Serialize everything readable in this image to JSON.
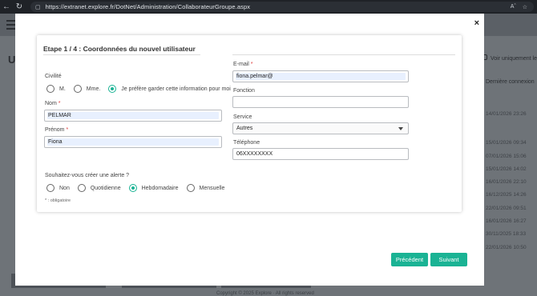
{
  "browser": {
    "url": "https://extranet.explore.fr/DotNet/Administration/CollaborateurGroupe.aspx",
    "reader_label": "Aˆ"
  },
  "background": {
    "title_fragment": "U",
    "right_checkbox_label": "Voir uniquement le",
    "column_header": "Dernière connexion",
    "dates": [
      "14/01/2026 23:26",
      "15/01/2026 09:34",
      "07/01/2026 15:06",
      "15/01/2026 14:02",
      "16/01/2026 22:10",
      "16/12/2025 14:26",
      "22/01/2026 09:51",
      "16/01/2026 16:27",
      "30/11/2025 18:33",
      "22/01/2026 10:50"
    ],
    "footer": "Copyright © 2025 Explore · All rights reserved"
  },
  "modal": {
    "close_glyph": "×",
    "step_title": "Etape 1 / 4 : Coordonnées du nouvel utilisateur",
    "civilite": {
      "label": "Civilité",
      "options": [
        "M.",
        "Mme.",
        "Je préfère garder cette information pour moi"
      ],
      "selected": 2
    },
    "nom": {
      "label": "Nom",
      "value": "PELMAR"
    },
    "prenom": {
      "label": "Prénom",
      "value": "Fiona"
    },
    "email": {
      "label": "E-mail",
      "value": "fiona.pelmar@"
    },
    "fonction": {
      "label": "Fonction",
      "value": ""
    },
    "service": {
      "label": "Service",
      "value": "Autres"
    },
    "telephone": {
      "label": "Téléphone",
      "value": "06XXXXXXXX"
    },
    "alerte": {
      "question": "Souhaitez-vous créer une alerte ?",
      "options": [
        "Non",
        "Quotidienne",
        "Hebdomadaire",
        "Mensuelle"
      ],
      "selected": 2
    },
    "required_marker": "*",
    "required_note": "* : obligatoire",
    "buttons": {
      "previous": "Précédent",
      "next": "Suivant"
    }
  },
  "colors": {
    "accent": "#1ab394",
    "required": "#e03a3a",
    "autofill": "#e8f0fe"
  }
}
